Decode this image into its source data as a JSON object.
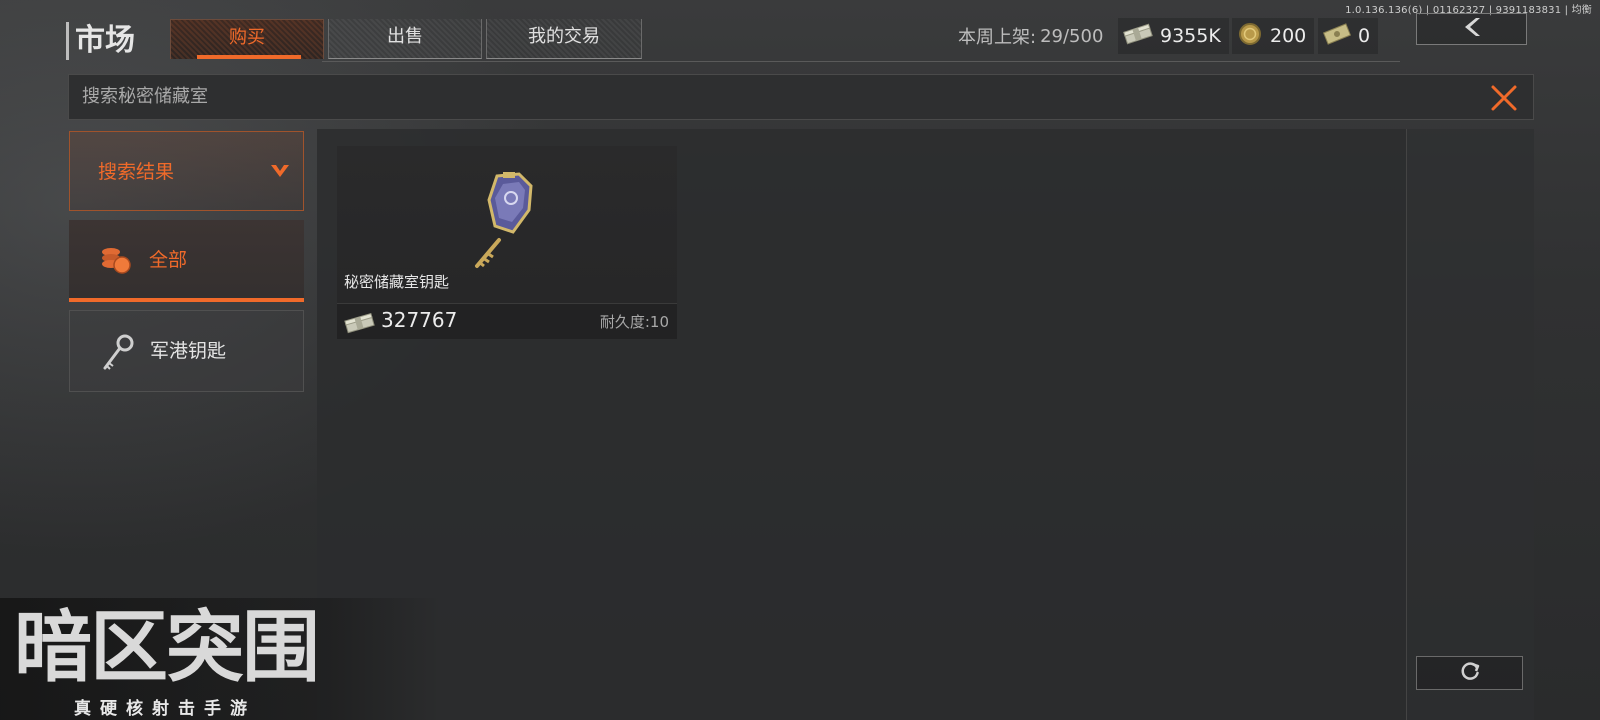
{
  "version_text": "1.0.136.136(6) | 01162327 | 9391183831 | 均衡",
  "header": {
    "title": "市场",
    "tabs": [
      {
        "label": "购买",
        "active": true
      },
      {
        "label": "出售",
        "active": false
      },
      {
        "label": "我的交易",
        "active": false
      }
    ],
    "weekly_label": "本周上架:",
    "weekly_value": "29/500",
    "currencies": [
      {
        "icon": "cash-stack-icon",
        "value": "9355K"
      },
      {
        "icon": "gold-coin-icon",
        "value": "200"
      },
      {
        "icon": "voucher-icon",
        "value": "0"
      }
    ],
    "back_icon": "chevron-left-icon"
  },
  "search": {
    "text": "搜索秘密储藏室",
    "clear_icon": "close-icon"
  },
  "filters": {
    "header_label": "搜索结果",
    "categories": [
      {
        "label": "全部",
        "icon": "coins-icon",
        "active": true
      },
      {
        "label": "军港钥匙",
        "icon": "key-icon",
        "active": false
      }
    ]
  },
  "items": [
    {
      "name": "秘密储藏室钥匙",
      "price": "327767",
      "durability_label": "耐久度:",
      "durability_value": "10",
      "icon": "secret-room-key-icon"
    }
  ],
  "refresh_icon": "refresh-icon",
  "logo": {
    "main": "暗区突围",
    "sub": "真硬核射击手游"
  },
  "colors": {
    "accent": "#f06a2a",
    "background": "#2b2c2d"
  }
}
